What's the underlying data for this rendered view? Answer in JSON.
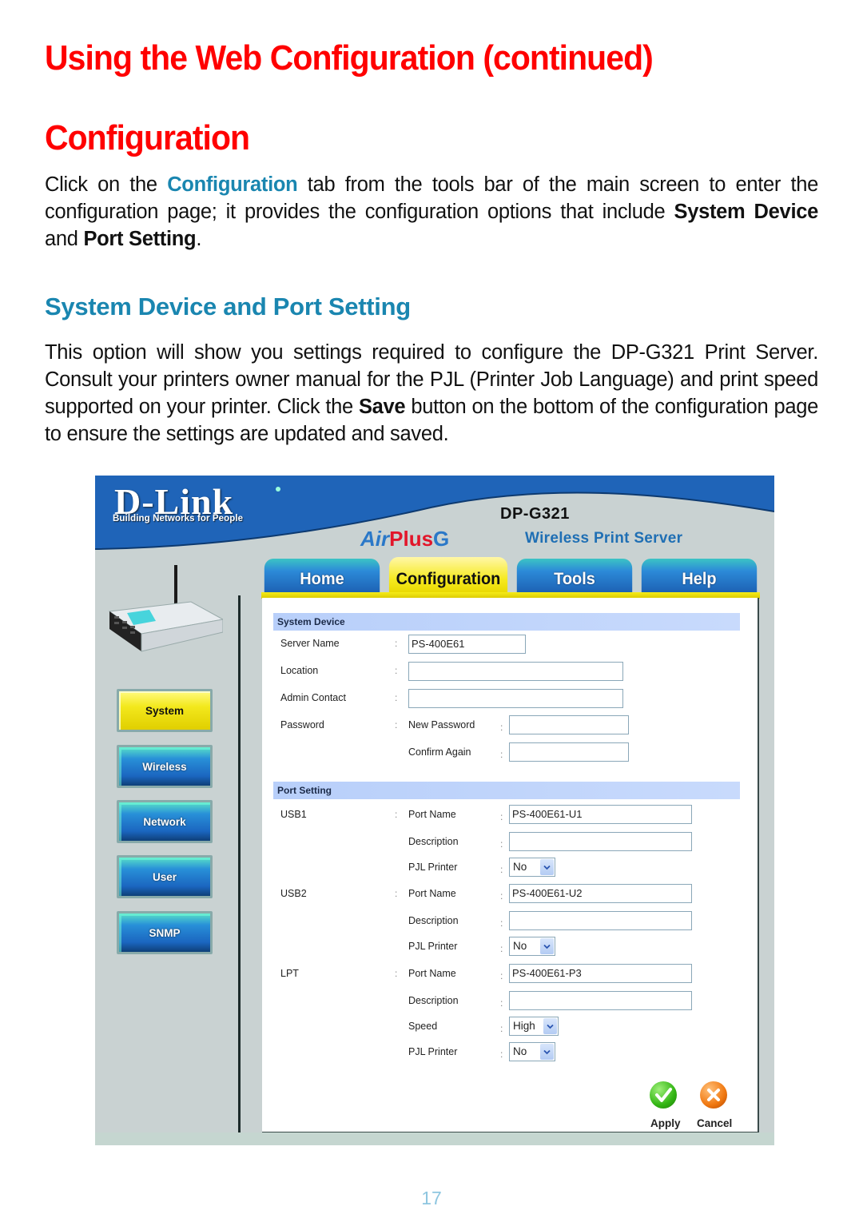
{
  "doc": {
    "title": "Using the Web Configuration (continued)",
    "section_title": "Configuration",
    "intro": {
      "part1": "Click on the ",
      "highlight": "Configuration",
      "part2": " tab from the tools bar of the main screen to enter the configuration page; it provides the configuration options that include ",
      "bold1": "System Device",
      "part3": " and ",
      "bold2": "Port Setting",
      "part4": "."
    },
    "subsection_title": "System Device and Port Setting",
    "body": {
      "part1": "This option will show you settings required to configure the DP-G321 Print Server. Consult your printers owner manual for the PJL (Printer Job Language) and print speed supported on your printer. Click the ",
      "bold": "Save",
      "part2": " button on the bottom of the configuration  page to ensure the settings are updated and saved."
    },
    "page_number": "17"
  },
  "ui": {
    "brand": {
      "logo": "D-Link",
      "tagline": "Building Networks for People",
      "model": "DP-G321",
      "product_air": "Air",
      "product_plus": "Plus",
      "product_g": "G",
      "product_desc": "Wireless Print Server"
    },
    "tabs": [
      {
        "label": "Home",
        "active": false
      },
      {
        "label": "Configuration",
        "active": true
      },
      {
        "label": "Tools",
        "active": false
      },
      {
        "label": "Help",
        "active": false
      }
    ],
    "sidebar": [
      {
        "label": "System",
        "active": true
      },
      {
        "label": "Wireless",
        "active": false
      },
      {
        "label": "Network",
        "active": false
      },
      {
        "label": "User",
        "active": false
      },
      {
        "label": "SNMP",
        "active": false
      }
    ],
    "system_device": {
      "heading": "System Device",
      "server_name_label": "Server Name",
      "server_name_value": "PS-400E61",
      "location_label": "Location",
      "location_value": "",
      "admin_contact_label": "Admin Contact",
      "admin_contact_value": "",
      "password_label": "Password",
      "new_password_label": "New Password",
      "new_password_value": "",
      "confirm_label": "Confirm Again",
      "confirm_value": ""
    },
    "port_setting": {
      "heading": "Port Setting",
      "port_name_label": "Port Name",
      "description_label": "Description",
      "pjl_label": "PJL Printer",
      "speed_label": "Speed",
      "usb1": {
        "label": "USB1",
        "port_name": "PS-400E61-U1",
        "description": "",
        "pjl": "No"
      },
      "usb2": {
        "label": "USB2",
        "port_name": "PS-400E61-U2",
        "description": "",
        "pjl": "No"
      },
      "lpt": {
        "label": "LPT",
        "port_name": "PS-400E61-P3",
        "description": "",
        "speed": "High",
        "pjl": "No"
      }
    },
    "colon": ":",
    "actions": {
      "apply": "Apply",
      "cancel": "Cancel"
    }
  }
}
